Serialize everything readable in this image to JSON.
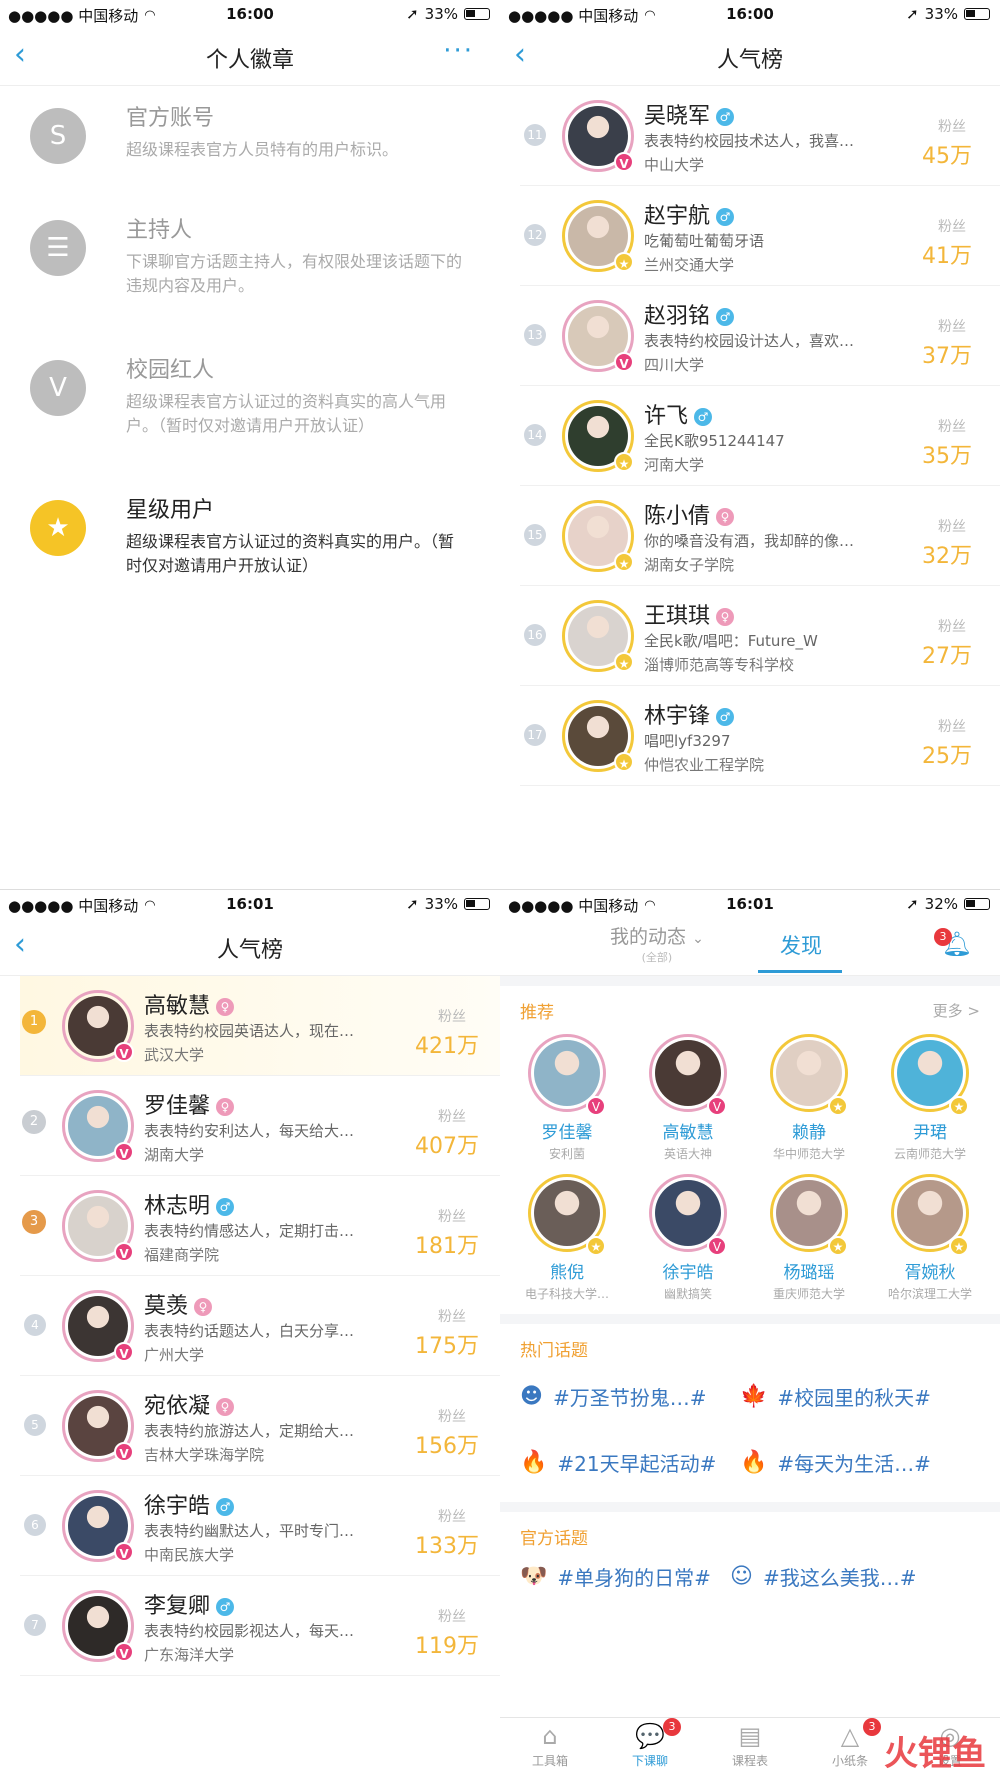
{
  "status_bars": [
    {
      "carrier": "●●●●● 中国移动",
      "time": "16:00",
      "battery": "33%"
    },
    {
      "carrier": "●●●●● 中国移动",
      "time": "16:00",
      "battery": "33%"
    },
    {
      "carrier": "●●●●● 中国移动",
      "time": "16:01",
      "battery": "33%"
    },
    {
      "carrier": "●●●●● 中国移动",
      "time": "16:01",
      "battery": "32%"
    }
  ],
  "badges_screen": {
    "title": "个人徽章",
    "more": "···",
    "items": [
      {
        "name": "官方账号",
        "desc": "超级课程表官方人员特有的用户标识。",
        "icon": "official-s-icon",
        "glyph": "S",
        "color": "#bdbdbd"
      },
      {
        "name": "主持人",
        "desc": "下课聊官方话题主持人，有权限处理该话题下的违规内容及用户。",
        "icon": "host-shield-icon",
        "glyph": "☰",
        "color": "#bdbdbd"
      },
      {
        "name": "校园红人",
        "desc": "超级课程表官方认证过的资料真实的高人气用户。（暂时仅对邀请用户开放认证）",
        "icon": "verified-v-icon",
        "glyph": "V",
        "color": "#bdbdbd"
      },
      {
        "name": "星级用户",
        "desc": "超级课程表官方认证过的资料真实的用户。（暂时仅对邀请用户开放认证）",
        "icon": "star-user-icon",
        "glyph": "★",
        "color": "#f5c426"
      }
    ]
  },
  "rank_screen_2": {
    "title": "人气榜",
    "fans_label": "粉丝",
    "rows": [
      {
        "rank": "11",
        "name": "吴晓军",
        "gender": "m",
        "desc": "表表特约校园技术达人，我喜…",
        "school": "中山大学",
        "fans": "45万",
        "badge": "V",
        "ring": "pink",
        "photo": "#3a3f4a"
      },
      {
        "rank": "12",
        "name": "赵宇航",
        "gender": "m",
        "desc": "吃葡萄吐葡萄牙语",
        "school": "兰州交通大学",
        "fans": "41万",
        "badge": "★",
        "ring": "gold",
        "photo": "#c9b8a8"
      },
      {
        "rank": "13",
        "name": "赵羽铭",
        "gender": "m",
        "desc": "表表特约校园设计达人，喜欢…",
        "school": "四川大学",
        "fans": "37万",
        "badge": "V",
        "ring": "pink",
        "photo": "#d8c9b9"
      },
      {
        "rank": "14",
        "name": "许飞",
        "gender": "m",
        "desc": "全民K歌951244147",
        "school": "河南大学",
        "fans": "35万",
        "badge": "★",
        "ring": "gold",
        "photo": "#2f3e2e"
      },
      {
        "rank": "15",
        "name": "陈小倩",
        "gender": "f",
        "desc": "你的嗓音没有酒，我却醉的像…",
        "school": "湖南女子学院",
        "fans": "32万",
        "badge": "★",
        "ring": "gold",
        "photo": "#e7d2c9"
      },
      {
        "rank": "16",
        "name": "王琪琪",
        "gender": "f",
        "desc": "全民k歌/唱吧：Future_W",
        "school": "淄博师范高等专科学校",
        "fans": "27万",
        "badge": "★",
        "ring": "gold",
        "photo": "#d9d3cf"
      },
      {
        "rank": "17",
        "name": "林宇锋",
        "gender": "m",
        "desc": "唱吧lyf3297",
        "school": "仲恺农业工程学院",
        "fans": "25万",
        "badge": "★",
        "ring": "gold",
        "photo": "#5a4a3a"
      }
    ]
  },
  "rank_screen_1": {
    "title": "人气榜",
    "fans_label": "粉丝",
    "rows": [
      {
        "rank": "1",
        "name": "高敏慧",
        "gender": "f",
        "desc": "表表特约校园英语达人，现在…",
        "school": "武汉大学",
        "fans": "421万",
        "badge": "V",
        "ring": "pink",
        "photo": "#4a3a35",
        "medal": "#f3b63a"
      },
      {
        "rank": "2",
        "name": "罗佳馨",
        "gender": "f",
        "desc": "表表特约安利达人，每天给大…",
        "school": "湖南大学",
        "fans": "407万",
        "badge": "V",
        "ring": "pink",
        "photo": "#8fb4c8",
        "medal": "#c9cdd2"
      },
      {
        "rank": "3",
        "name": "林志明",
        "gender": "m",
        "desc": "表表特约情感达人，定期打击…",
        "school": "福建商学院",
        "fans": "181万",
        "badge": "V",
        "ring": "pink",
        "photo": "#d8d2cc",
        "medal": "#e59a4a"
      },
      {
        "rank": "4",
        "name": "莫羡",
        "gender": "f",
        "desc": "表表特约话题达人，白天分享…",
        "school": "广州大学",
        "fans": "175万",
        "badge": "V",
        "ring": "pink",
        "photo": "#3c3533"
      },
      {
        "rank": "5",
        "name": "宛依凝",
        "gender": "f",
        "desc": "表表特约旅游达人，定期给大…",
        "school": "吉林大学珠海学院",
        "fans": "156万",
        "badge": "V",
        "ring": "pink",
        "photo": "#5a4440"
      },
      {
        "rank": "6",
        "name": "徐宇皓",
        "gender": "m",
        "desc": "表表特约幽默达人，平时专门…",
        "school": "中南民族大学",
        "fans": "133万",
        "badge": "V",
        "ring": "pink",
        "photo": "#3b4a66"
      },
      {
        "rank": "7",
        "name": "李复卿",
        "gender": "m",
        "desc": "表表特约校园影视达人，每天…",
        "school": "广东海洋大学",
        "fans": "119万",
        "badge": "V",
        "ring": "pink",
        "photo": "#2e2a28"
      }
    ]
  },
  "discover_screen": {
    "tab_my": "我的动态",
    "tab_my_sub": "(全部)",
    "tab_find": "发现",
    "bell_count": "3",
    "recommend": {
      "title": "推荐",
      "more": "更多 >",
      "users": [
        {
          "name": "罗佳馨",
          "sub": "安利菌",
          "badge": "V",
          "ring": "pink",
          "photo": "#8fb4c8"
        },
        {
          "name": "高敏慧",
          "sub": "英语大神",
          "badge": "V",
          "ring": "pink",
          "photo": "#4a3a35"
        },
        {
          "name": "赖静",
          "sub": "华中师范大学",
          "badge": "★",
          "ring": "gold",
          "photo": "#e0cfc3"
        },
        {
          "name": "尹珺",
          "sub": "云南师范大学",
          "badge": "★",
          "ring": "gold",
          "photo": "#4fb3d9"
        },
        {
          "name": "熊倪",
          "sub": "电子科技大学…",
          "badge": "★",
          "ring": "gold",
          "photo": "#6a5e58"
        },
        {
          "name": "徐宇皓",
          "sub": "幽默搞笑",
          "badge": "V",
          "ring": "pink",
          "photo": "#3b4a66"
        },
        {
          "name": "杨璐瑶",
          "sub": "重庆师范大学",
          "badge": "★",
          "ring": "gold",
          "photo": "#a8908a"
        },
        {
          "name": "胥婉秋",
          "sub": "哈尔滨理工大学",
          "badge": "★",
          "ring": "gold",
          "photo": "#b5998a"
        }
      ]
    },
    "hot": {
      "title": "热门话题",
      "topics": [
        {
          "text": "#万圣节扮鬼…#",
          "icon": "ghost-icon",
          "glyph": "☻"
        },
        {
          "text": "#校园里的秋天#",
          "icon": "maple-leaf-icon",
          "glyph": "🍁"
        },
        {
          "text": "#21天早起活动#",
          "icon": "fire-icon",
          "glyph": "🔥"
        },
        {
          "text": "#每天为生活…#",
          "icon": "fire-icon",
          "glyph": "🔥"
        }
      ]
    },
    "official": {
      "title": "官方话题",
      "topics": [
        {
          "text": "#单身狗的日常#",
          "icon": "dog-icon",
          "glyph": "🐶"
        },
        {
          "text": "#我这么美我…#",
          "icon": "cartoon-face-icon",
          "glyph": "☺"
        }
      ]
    },
    "tabbar": [
      {
        "label": "工具箱",
        "icon": "toolbox-icon",
        "glyph": "⌂",
        "active": false
      },
      {
        "label": "下课聊",
        "icon": "chat-icon",
        "glyph": "💬",
        "active": true,
        "count": "3"
      },
      {
        "label": "课程表",
        "icon": "timetable-icon",
        "glyph": "▤",
        "active": false
      },
      {
        "label": "小纸条",
        "icon": "note-icon",
        "glyph": "△",
        "active": false,
        "count": "3"
      },
      {
        "label": "设置",
        "icon": "settings-icon",
        "glyph": "◎",
        "active": false
      }
    ],
    "watermark": "火锂鱼"
  }
}
